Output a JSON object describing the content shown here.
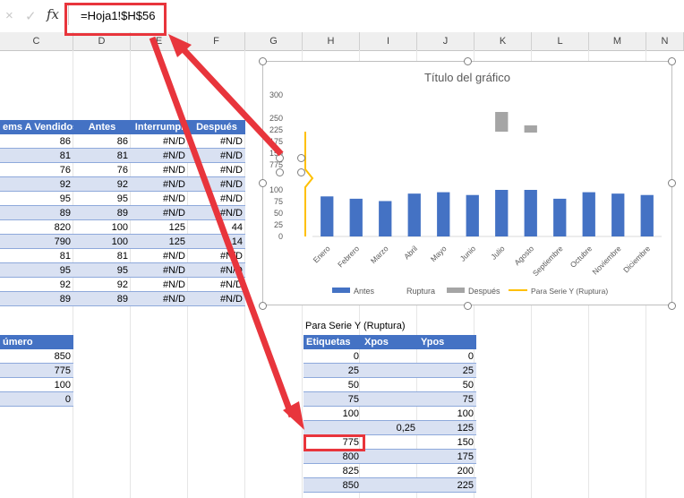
{
  "formula_bar": {
    "cancel_icon": "×",
    "enter_icon": "✓",
    "fx_label": "fx",
    "formula": "=Hoja1!$H$56"
  },
  "columns": [
    "C",
    "D",
    "E",
    "F",
    "G",
    "H",
    "I",
    "J",
    "K",
    "L",
    "M",
    "N"
  ],
  "table1": {
    "headers": [
      "ems A Vendidos",
      "Antes",
      "Interrumpi",
      "Después"
    ],
    "rows": [
      [
        "86",
        "86",
        "#N/D",
        "#N/D"
      ],
      [
        "81",
        "81",
        "#N/D",
        "#N/D"
      ],
      [
        "76",
        "76",
        "#N/D",
        "#N/D"
      ],
      [
        "92",
        "92",
        "#N/D",
        "#N/D"
      ],
      [
        "95",
        "95",
        "#N/D",
        "#N/D"
      ],
      [
        "89",
        "89",
        "#N/D",
        "#N/D"
      ],
      [
        "820",
        "100",
        "125",
        "44"
      ],
      [
        "790",
        "100",
        "125",
        "14"
      ],
      [
        "81",
        "81",
        "#N/D",
        "#N/D"
      ],
      [
        "95",
        "95",
        "#N/D",
        "#N/D"
      ],
      [
        "92",
        "92",
        "#N/D",
        "#N/D"
      ],
      [
        "89",
        "89",
        "#N/D",
        "#N/D"
      ]
    ]
  },
  "table2": {
    "header": "úmero",
    "rows": [
      "850",
      "775",
      "100",
      "0"
    ]
  },
  "table3": {
    "caption": "Para Serie Y (Ruptura)",
    "headers": [
      "Etiquetas",
      "Xpos",
      "Ypos"
    ],
    "rows": [
      [
        "0",
        "",
        "0"
      ],
      [
        "25",
        "",
        "25"
      ],
      [
        "50",
        "",
        "50"
      ],
      [
        "75",
        "",
        "75"
      ],
      [
        "100",
        "",
        "100"
      ],
      [
        "",
        "0,25",
        "125"
      ],
      [
        "775",
        "",
        "150"
      ],
      [
        "800",
        "",
        "175"
      ],
      [
        "825",
        "",
        "200"
      ],
      [
        "850",
        "",
        "225"
      ]
    ]
  },
  "chart_data": {
    "type": "bar",
    "title": "Título del gráfico",
    "categories": [
      "Enero",
      "Febrero",
      "Marzo",
      "Abril",
      "Mayo",
      "Junio",
      "Julio",
      "Agosto",
      "Septiembre",
      "Octubre",
      "Noviembre",
      "Diciembre"
    ],
    "series": [
      {
        "name": "Antes",
        "color": "#4472c4",
        "values": [
          86,
          81,
          76,
          92,
          95,
          89,
          100,
          100,
          81,
          95,
          92,
          89
        ]
      },
      {
        "name": "Ruptura",
        "color": "#ed7d31",
        "values": [
          null,
          null,
          null,
          null,
          null,
          null,
          125,
          125,
          null,
          null,
          null,
          null
        ]
      },
      {
        "name": "Después",
        "color": "#a5a5a5",
        "values": [
          null,
          null,
          null,
          null,
          null,
          null,
          44,
          14,
          null,
          null,
          null,
          null
        ]
      },
      {
        "name": "Para Serie Y (Ruptura)",
        "color": "#ffc000"
      }
    ],
    "y_ticks_lower": [
      "0",
      "25",
      "50",
      "75",
      "100"
    ],
    "y_ticks_upper": [
      "775",
      "150",
      "175",
      "225",
      "250",
      "300"
    ],
    "legend": [
      "Antes",
      "Ruptura",
      "Después",
      "Para Serie Y (Ruptura)"
    ],
    "legend_position": "bottom",
    "grid": false
  },
  "colors": {
    "header": "#4472c4",
    "band": "#d9e1f2",
    "annotation": "#e8353c"
  }
}
